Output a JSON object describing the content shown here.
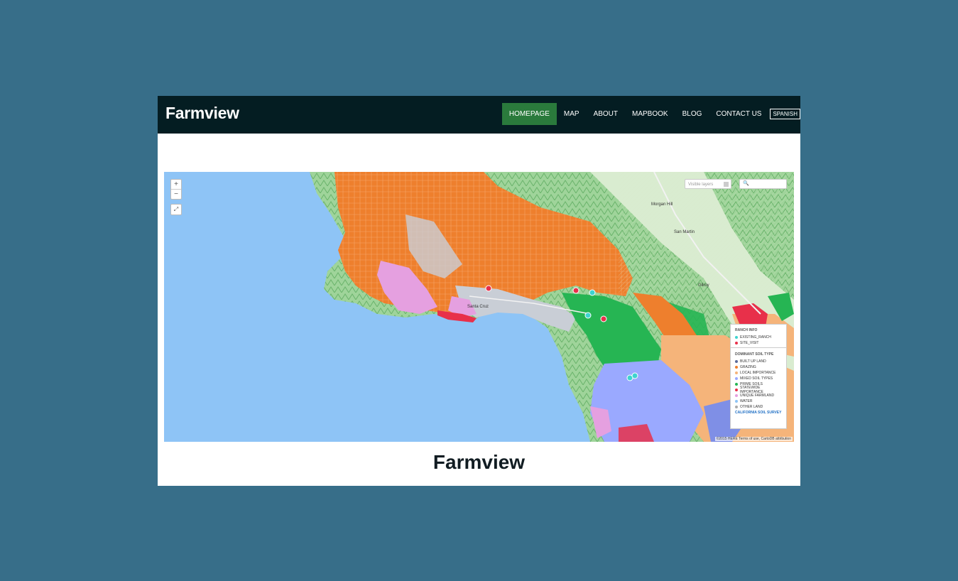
{
  "colors": {
    "background": "#376e89",
    "navbar": "#041d22",
    "active_nav": "#2a7a3c",
    "ocean": "#8ec4f6",
    "grazing": "#ee7f2d",
    "prime_soils": "#26b553",
    "built_up": "#9aa9ff",
    "local_importance": "#f5b47a",
    "unique_farmland": "#e5a0e0",
    "statewide": "#e8304a"
  },
  "header": {
    "brand": "Farmview",
    "nav": [
      {
        "label": "HOMEPAGE",
        "active": true
      },
      {
        "label": "MAP"
      },
      {
        "label": "ABOUT"
      },
      {
        "label": "MAPBOOK"
      },
      {
        "label": "BLOG"
      },
      {
        "label": "CONTACT US"
      }
    ],
    "language_button": "SPANISH"
  },
  "map": {
    "zoom_in": "+",
    "zoom_out": "−",
    "fullscreen_icon": "⤢",
    "layers_placeholder": "Visible layers",
    "search_icon": "🔍",
    "place_labels": [
      "Morgan Hill",
      "San Martin",
      "Gilroy",
      "Santa Cruz"
    ],
    "legend": {
      "ranch_title": "RANCH INFO",
      "ranch_items": [
        {
          "label": "EXISTING_RANCH",
          "color": "#3fd3d0"
        },
        {
          "label": "SITE_VISIT",
          "color": "#e8304a"
        }
      ],
      "soil_title": "DOMINANT SOIL TYPE",
      "soil_items": [
        {
          "label": "BUILT UP LAND",
          "color": "#5a6b9b"
        },
        {
          "label": "GRAZING",
          "color": "#ee7f2d"
        },
        {
          "label": "LOCAL IMPORTANCE",
          "color": "#f5b47a"
        },
        {
          "label": "MIXED SOIL TYPES",
          "color": "#9aa9ff"
        },
        {
          "label": "PRIME SOILS",
          "color": "#26b553"
        },
        {
          "label": "STATEWIDE IMPORTANCE",
          "color": "#e8304a"
        },
        {
          "label": "UNIQUE FARMLAND",
          "color": "#e5a0e0"
        },
        {
          "label": "WATER",
          "color": "#8ec4f6"
        },
        {
          "label": "OTHER LAND",
          "color": "#aaaaaa"
        }
      ],
      "survey_link": "CALIFORNIA SOIL SURVEY"
    },
    "attribution": "©2015 HERE Terms of use, CartoDB attribution"
  },
  "page_title": "Farmview"
}
